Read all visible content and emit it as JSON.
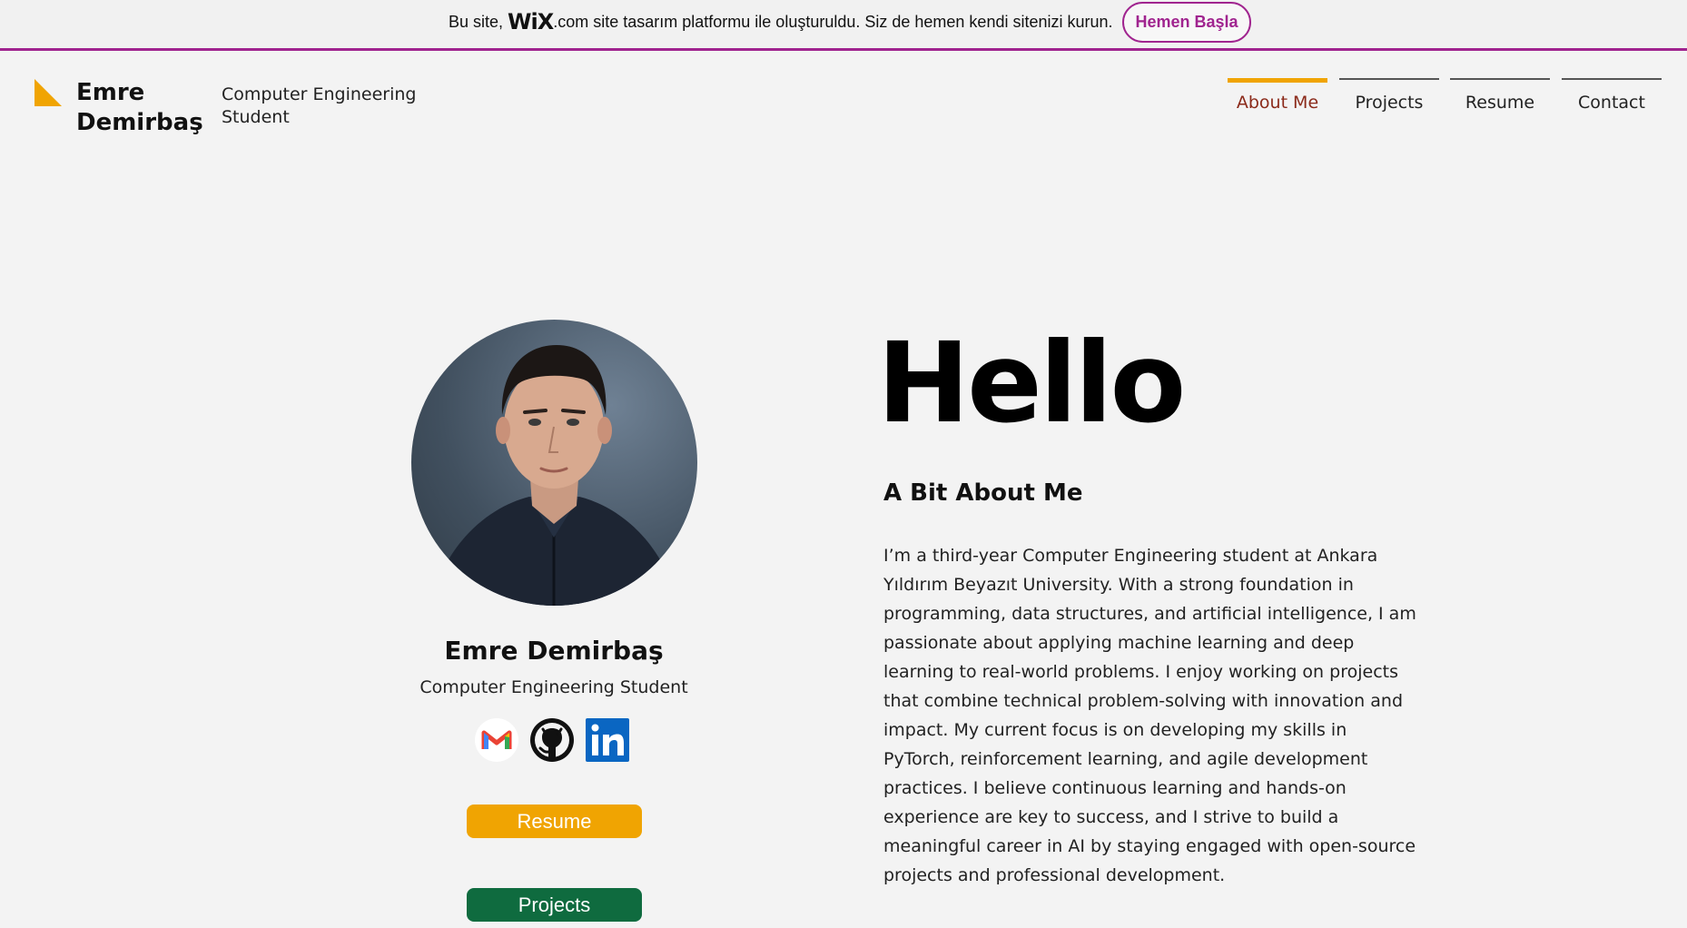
{
  "banner": {
    "text_before": "Bu site, ",
    "logo": "WiX",
    "text_after": ".com site tasarım platformu ile oluşturuldu. Siz de hemen kendi sitenizi kurun.",
    "cta_label": "Hemen Başla",
    "accent_color": "#a0248f"
  },
  "header": {
    "brand_name": "Emre Demirbaş",
    "brand_subtitle": "Computer Engineering Student",
    "logo_icon": "triangle-logo-icon",
    "nav": [
      {
        "label": "About Me",
        "active": true
      },
      {
        "label": "Projects",
        "active": false
      },
      {
        "label": "Resume",
        "active": false
      },
      {
        "label": "Contact",
        "active": false
      }
    ]
  },
  "profile": {
    "name": "Emre Demirbaş",
    "role": "Computer Engineering Student",
    "photo": "profile-photo",
    "social": [
      {
        "name": "gmail-icon"
      },
      {
        "name": "github-icon"
      },
      {
        "name": "linkedin-icon"
      }
    ],
    "resume_button": "Resume",
    "projects_button": "Projects"
  },
  "about": {
    "greeting": "Hello",
    "heading": "A Bit About Me",
    "body": "I’m a third-year Computer Engineering student at Ankara Yıldırım Beyazıt University. With a strong foundation in programming, data structures, and artificial intelligence, I am passionate about applying machine learning and deep learning to real-world problems. I enjoy working on projects that combine technical problem-solving with innovation and impact. My current focus is on developing my skills in PyTorch, reinforcement learning, and agile development practices. I believe continuous learning and hands-on experience are key to success, and I strive to build a meaningful career in AI by staying engaged with open-source projects and professional development."
  },
  "colors": {
    "accent_orange": "#f0a402",
    "projects_green": "#0f6b3f",
    "active_nav_text": "#8b2a1a",
    "background": "#f3f3f3"
  }
}
